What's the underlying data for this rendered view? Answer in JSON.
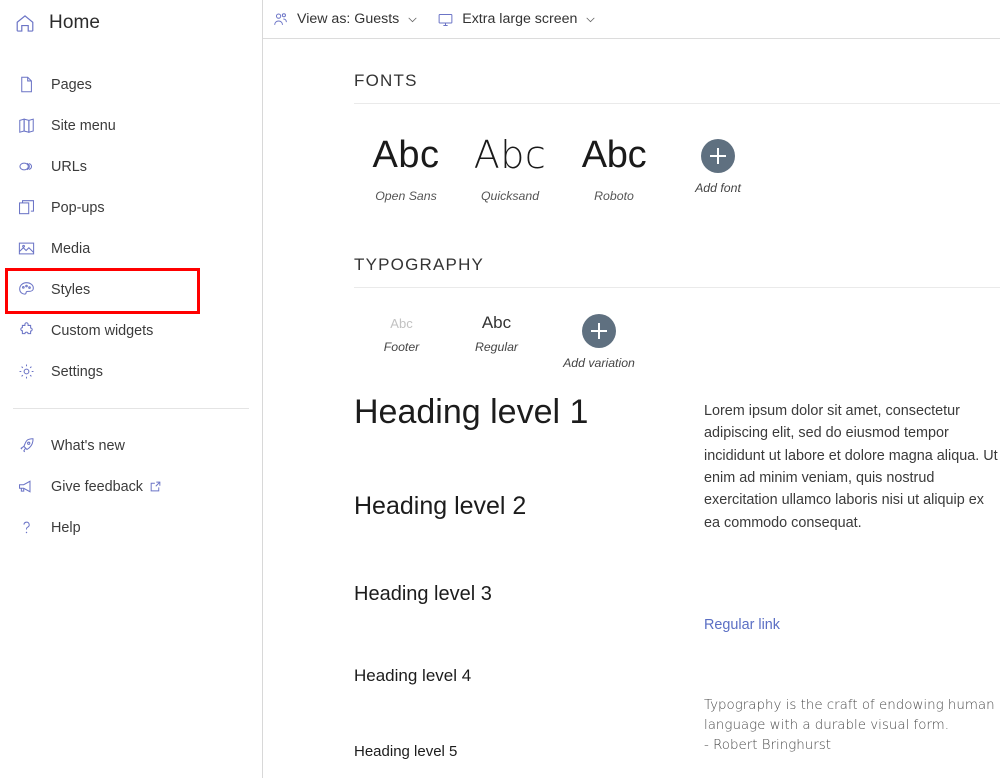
{
  "sidebar": {
    "home": {
      "label": "Home",
      "icon": "home-icon"
    },
    "items": [
      {
        "label": "Pages",
        "icon": "page-icon"
      },
      {
        "label": "Site menu",
        "icon": "book-icon"
      },
      {
        "label": "URLs",
        "icon": "link-icon"
      },
      {
        "label": "Pop-ups",
        "icon": "popups-icon"
      },
      {
        "label": "Media",
        "icon": "image-icon"
      },
      {
        "label": "Styles",
        "icon": "palette-icon"
      },
      {
        "label": "Custom widgets",
        "icon": "puzzle-icon"
      },
      {
        "label": "Settings",
        "icon": "gear-icon"
      }
    ],
    "bottom_items": [
      {
        "label": "What's new",
        "icon": "rocket-icon",
        "external": false
      },
      {
        "label": "Give feedback",
        "icon": "megaphone-icon",
        "external": true
      },
      {
        "label": "Help",
        "icon": "question-icon",
        "external": false
      }
    ],
    "selected": "Styles"
  },
  "toolbar": {
    "view_as": {
      "label": "View as: Guests",
      "icon": "people-icon",
      "chevron": "chevron-down-icon"
    },
    "screen_size": {
      "label": "Extra large screen",
      "icon": "monitor-icon",
      "chevron": "chevron-down-icon"
    }
  },
  "fonts_section": {
    "title": "FONTS",
    "fonts": [
      {
        "sample": "Abc",
        "name": "Open Sans"
      },
      {
        "sample": "Abc",
        "name": "Quicksand"
      },
      {
        "sample": "Abc",
        "name": "Roboto"
      }
    ],
    "add_label": "Add font"
  },
  "typography_section": {
    "title": "TYPOGRAPHY",
    "variations": [
      {
        "sample": "Abc",
        "name": "Footer"
      },
      {
        "sample": "Abc",
        "name": "Regular"
      }
    ],
    "add_label": "Add variation",
    "headings": [
      "Heading level 1",
      "Heading level 2",
      "Heading level 3",
      "Heading level 4",
      "Heading level 5"
    ],
    "paragraph": "Lorem ipsum dolor sit amet, consectetur adipiscing elit, sed do eiusmod tempor incididunt ut labore et dolore magna aliqua. Ut enim ad minim veniam, quis nostrud exercitation ullamco laboris nisi ut aliquip ex ea commodo consequat.",
    "link_label": "Regular link",
    "quote_text": "Typography is the craft of endowing human language with a durable visual form.",
    "quote_author": "- Robert Bringhurst"
  },
  "annotation": {
    "highlight_color": "#ff0000",
    "target": "Styles"
  },
  "colors": {
    "icon_blue": "#6b74c6",
    "accent_circle": "#5f7080",
    "link": "#5b6fc4",
    "text": "#333333"
  }
}
